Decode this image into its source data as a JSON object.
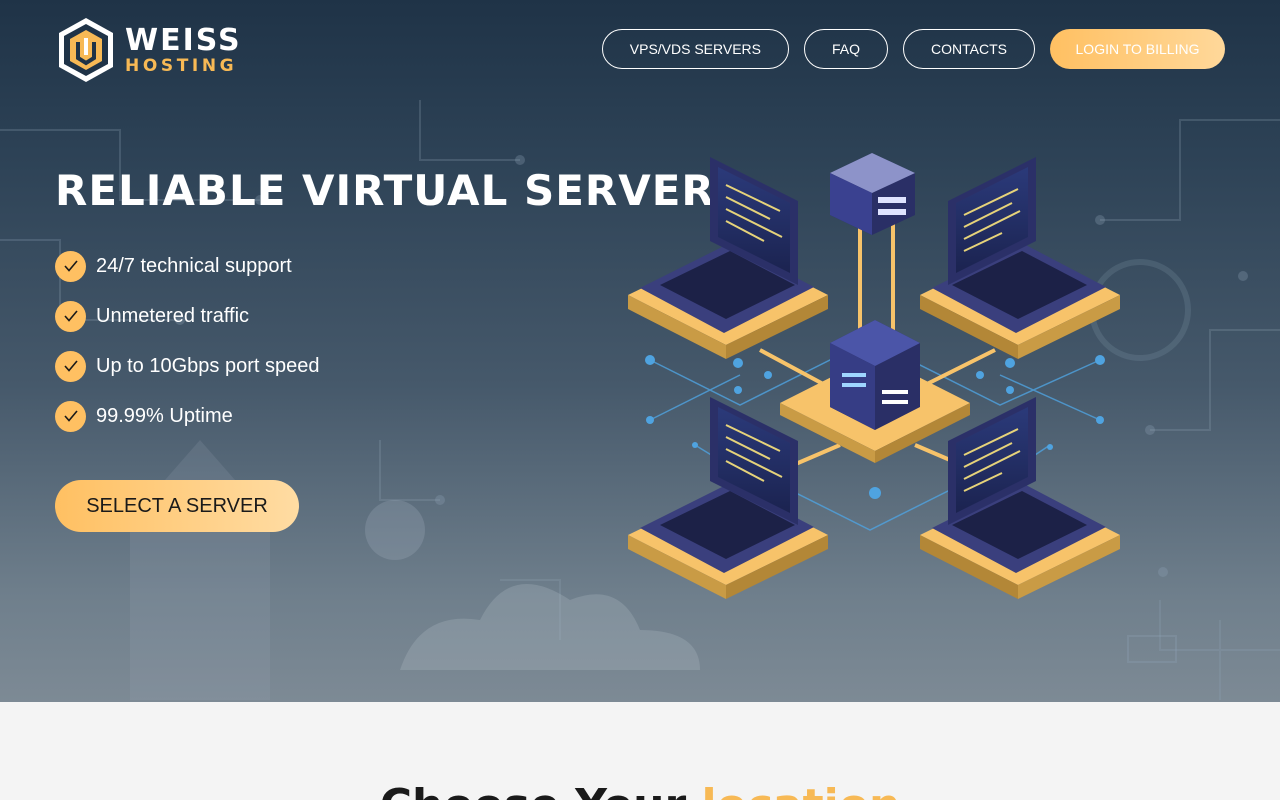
{
  "brand": {
    "name_top": "WEISS",
    "name_bottom": "HOSTING",
    "accent_color": "#f7b955"
  },
  "nav": {
    "items": [
      {
        "label": "VPS/VDS SERVERS"
      },
      {
        "label": "FAQ"
      },
      {
        "label": "CONTACTS"
      }
    ],
    "login_label": "LOGIN TO BILLING"
  },
  "hero": {
    "title": "RELIABLE VIRTUAL SERVERS",
    "features": [
      {
        "label": "24/7 technical support",
        "icon": "check-icon"
      },
      {
        "label": "Unmetered traffic",
        "icon": "check-icon"
      },
      {
        "label": "Up to 10Gbps port speed",
        "icon": "check-icon"
      },
      {
        "label": "99.99% Uptime",
        "icon": "check-icon"
      }
    ],
    "cta_label": "SELECT A SERVER"
  },
  "section2": {
    "title_start": "Choose Your ",
    "title_accent": "location"
  }
}
